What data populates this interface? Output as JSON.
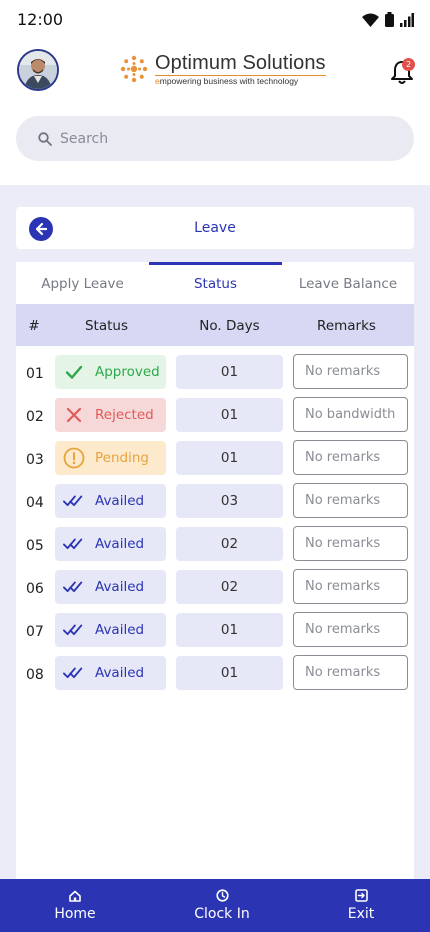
{
  "status_bar": {
    "time": "12:00"
  },
  "header": {
    "logo_title": "Optimum Solutions",
    "logo_subtitle_initial": "e",
    "logo_subtitle_rest": "mpowering business with technology",
    "notification_count": "2"
  },
  "search": {
    "placeholder": "Search"
  },
  "page": {
    "title": "Leave"
  },
  "tabs": [
    {
      "label": "Apply Leave",
      "active": false
    },
    {
      "label": "Status",
      "active": true
    },
    {
      "label": "Leave Balance",
      "active": false
    }
  ],
  "table": {
    "headers": [
      "#",
      "Status",
      "No. Days",
      "Remarks"
    ],
    "rows": [
      {
        "num": "01",
        "status": "Approved",
        "status_icon": "check-icon",
        "days": "01",
        "remarks": "No remarks"
      },
      {
        "num": "02",
        "status": "Rejected",
        "status_icon": "x-icon",
        "days": "01",
        "remarks": "No bandwidth"
      },
      {
        "num": "03",
        "status": "Pending",
        "status_icon": "alert-icon",
        "days": "01",
        "remarks": "No remarks"
      },
      {
        "num": "04",
        "status": "Availed",
        "status_icon": "double-check-icon",
        "days": "03",
        "remarks": "No remarks"
      },
      {
        "num": "05",
        "status": "Availed",
        "status_icon": "double-check-icon",
        "days": "02",
        "remarks": "No remarks"
      },
      {
        "num": "06",
        "status": "Availed",
        "status_icon": "double-check-icon",
        "days": "02",
        "remarks": "No remarks"
      },
      {
        "num": "07",
        "status": "Availed",
        "status_icon": "double-check-icon",
        "days": "01",
        "remarks": "No remarks"
      },
      {
        "num": "08",
        "status": "Availed",
        "status_icon": "double-check-icon",
        "days": "01",
        "remarks": "No remarks"
      }
    ]
  },
  "bottom_nav": [
    {
      "label": "Home",
      "icon": "home-icon"
    },
    {
      "label": "Clock In",
      "icon": "clock-icon"
    },
    {
      "label": "Exit",
      "icon": "exit-icon"
    }
  ],
  "colors": {
    "primary": "#2b35b4",
    "approved": "#2ea84a",
    "rejected": "#e05a5a",
    "pending": "#e8a33d",
    "header_row": "#d6d8f4"
  }
}
